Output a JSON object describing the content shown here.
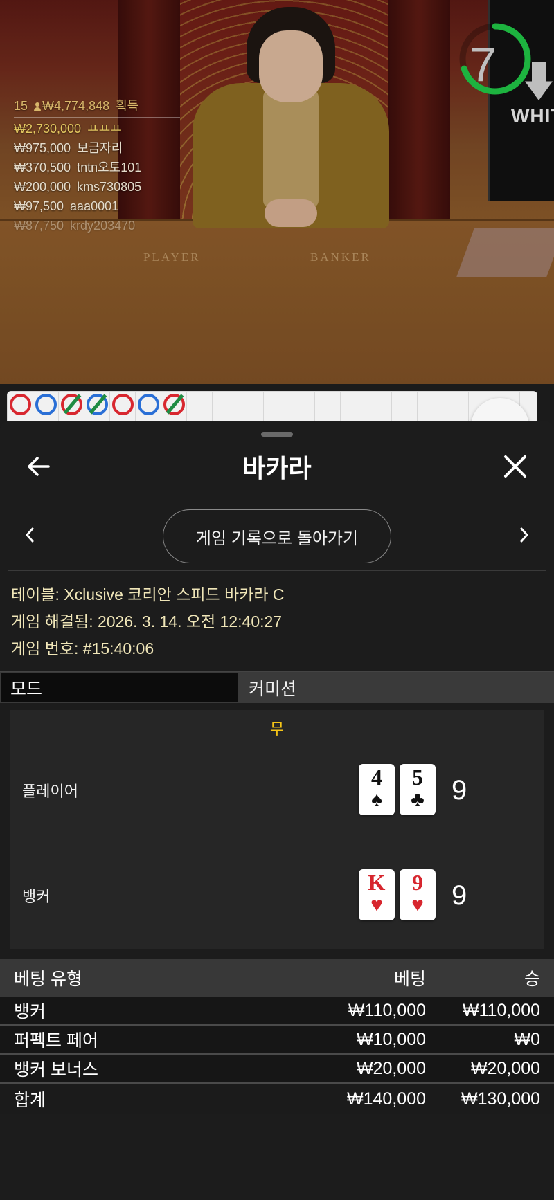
{
  "video": {
    "table_labels": {
      "player": "PLAYER",
      "banker": "BANKER"
    },
    "timer": {
      "value": "7",
      "progress_fraction": 0.7,
      "color": "#1db33f"
    },
    "side_label": "WHIT"
  },
  "winners": {
    "header": {
      "count": "15",
      "total": "₩4,774,848",
      "suffix": "획득"
    },
    "rows": [
      {
        "amount": "₩2,730,000",
        "name": "ㅛㅛㅛ"
      },
      {
        "amount": "₩975,000",
        "name": "보금자리"
      },
      {
        "amount": "₩370,500",
        "name": "tntn오토101"
      },
      {
        "amount": "₩200,000",
        "name": "kms730805"
      },
      {
        "amount": "₩97,500",
        "name": "aaa0001"
      },
      {
        "amount": "₩87,750",
        "name": "krdy203470"
      }
    ]
  },
  "roadmap": {
    "beads": [
      "banker",
      "player",
      "banker-tie",
      "player-tie",
      "banker",
      "player",
      "banker-tie"
    ],
    "colors": {
      "banker": "#d8272f",
      "player": "#2a6fd6",
      "tie": "#1f8c43"
    }
  },
  "sheet": {
    "title": "바카라",
    "back_icon": "arrow-left-icon",
    "close_icon": "close-icon",
    "history_button": "게임 기록으로 돌아가기",
    "info": {
      "table": "테이블: Xclusive 코리안 스피드 바카라 C",
      "resolved": "게임 해결됨: 2026. 3. 14. 오전 12:40:27",
      "number": "게임 번호: #15:40:06"
    },
    "tabs": {
      "mode": "모드",
      "commission": "커미션"
    },
    "result": {
      "outcome": "무",
      "player": {
        "label": "플레이어",
        "cards": [
          {
            "rank": "4",
            "suit": "♠"
          },
          {
            "rank": "5",
            "suit": "♣"
          }
        ],
        "total": "9"
      },
      "banker": {
        "label": "뱅커",
        "cards": [
          {
            "rank": "K",
            "suit": "♥"
          },
          {
            "rank": "9",
            "suit": "♥"
          }
        ],
        "total": "9"
      }
    },
    "bets": {
      "headers": {
        "type": "베팅 유형",
        "bet": "베팅",
        "win": "승"
      },
      "rows": [
        {
          "type": "뱅커",
          "bet": "₩110,000",
          "win": "₩110,000"
        },
        {
          "type": "퍼펙트 페어",
          "bet": "₩10,000",
          "win": "₩0"
        },
        {
          "type": "뱅커 보너스",
          "bet": "₩20,000",
          "win": "₩20,000"
        }
      ],
      "total": {
        "type": "합계",
        "bet": "₩140,000",
        "win": "₩130,000"
      }
    }
  }
}
